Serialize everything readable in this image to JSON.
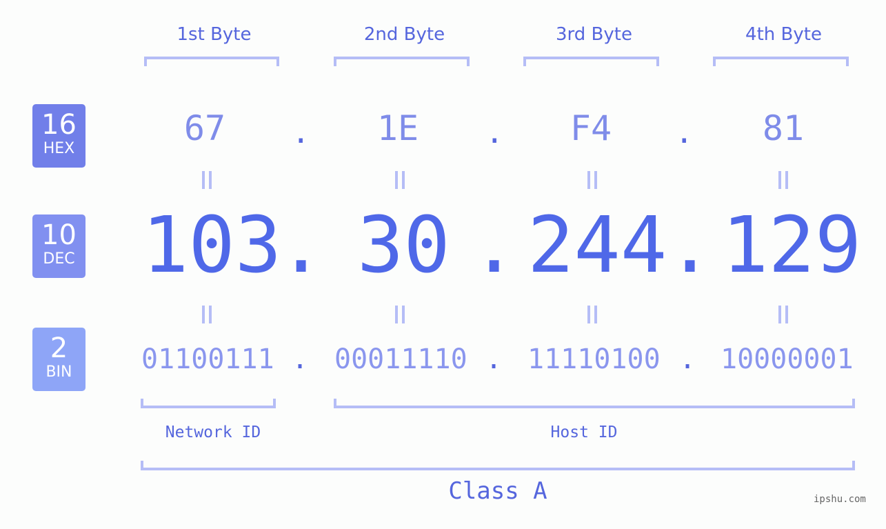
{
  "colors": {
    "hex_badge": "#717fe9",
    "dec_badge": "#8190f0",
    "bin_badge": "#8ea5f7",
    "accent": "#4f68e8",
    "bracket": "#b5bdf6"
  },
  "badges": [
    {
      "num": "16",
      "label": "HEX"
    },
    {
      "num": "10",
      "label": "DEC"
    },
    {
      "num": "2",
      "label": "BIN"
    }
  ],
  "byte_headers": [
    "1st Byte",
    "2nd Byte",
    "3rd Byte",
    "4th Byte"
  ],
  "separator": ".",
  "hex": [
    "67",
    "1E",
    "F4",
    "81"
  ],
  "dec": [
    "103",
    "30",
    "244",
    "129"
  ],
  "bin": [
    "01100111",
    "00011110",
    "11110100",
    "10000001"
  ],
  "network_label": "Network ID",
  "host_label": "Host ID",
  "class_label": "Class A",
  "watermark": "ipshu.com"
}
